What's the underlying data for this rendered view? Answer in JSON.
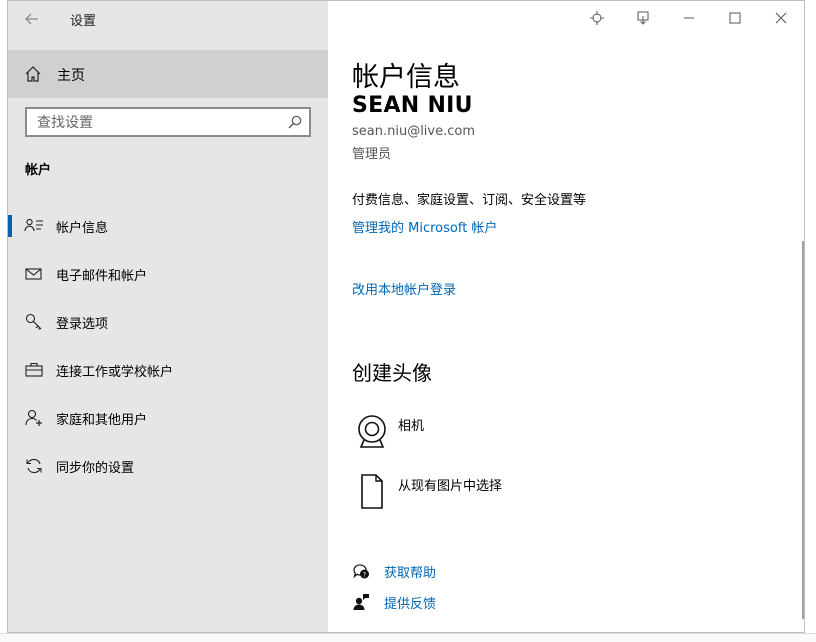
{
  "window": {
    "title": "设置",
    "back_icon": "arrow-left-icon"
  },
  "sidebar": {
    "home_label": "主页",
    "search_placeholder": "查找设置",
    "section_title": "帐户",
    "items": [
      {
        "label": "帐户信息",
        "icon": "person-card-icon",
        "active": true
      },
      {
        "label": "电子邮件和帐户",
        "icon": "mail-icon"
      },
      {
        "label": "登录选项",
        "icon": "key-icon"
      },
      {
        "label": "连接工作或学校帐户",
        "icon": "briefcase-icon"
      },
      {
        "label": "家庭和其他用户",
        "icon": "person-add-icon"
      },
      {
        "label": "同步你的设置",
        "icon": "sync-icon"
      }
    ]
  },
  "main": {
    "page_title": "帐户信息",
    "user_name": "SEAN NIU",
    "user_email": "sean.niu@live.com",
    "user_role": "管理员",
    "description": "付费信息、家庭设置、订阅、安全设置等",
    "manage_link": "管理我的 Microsoft 帐户",
    "local_account_link": "改用本地帐户登录",
    "avatar_section_title": "创建头像",
    "avatar_options": [
      {
        "label": "相机",
        "icon": "camera-icon"
      },
      {
        "label": "从现有图片中选择",
        "icon": "picture-file-icon"
      }
    ],
    "help_links": [
      {
        "label": "获取帮助",
        "icon": "help-chat-icon"
      },
      {
        "label": "提供反馈",
        "icon": "feedback-icon"
      }
    ]
  },
  "colors": {
    "sidebar_bg": "#e6e6e6",
    "home_selected_bg": "#d0d0d0",
    "accent": "#0063b1",
    "link": "#0066b4"
  }
}
